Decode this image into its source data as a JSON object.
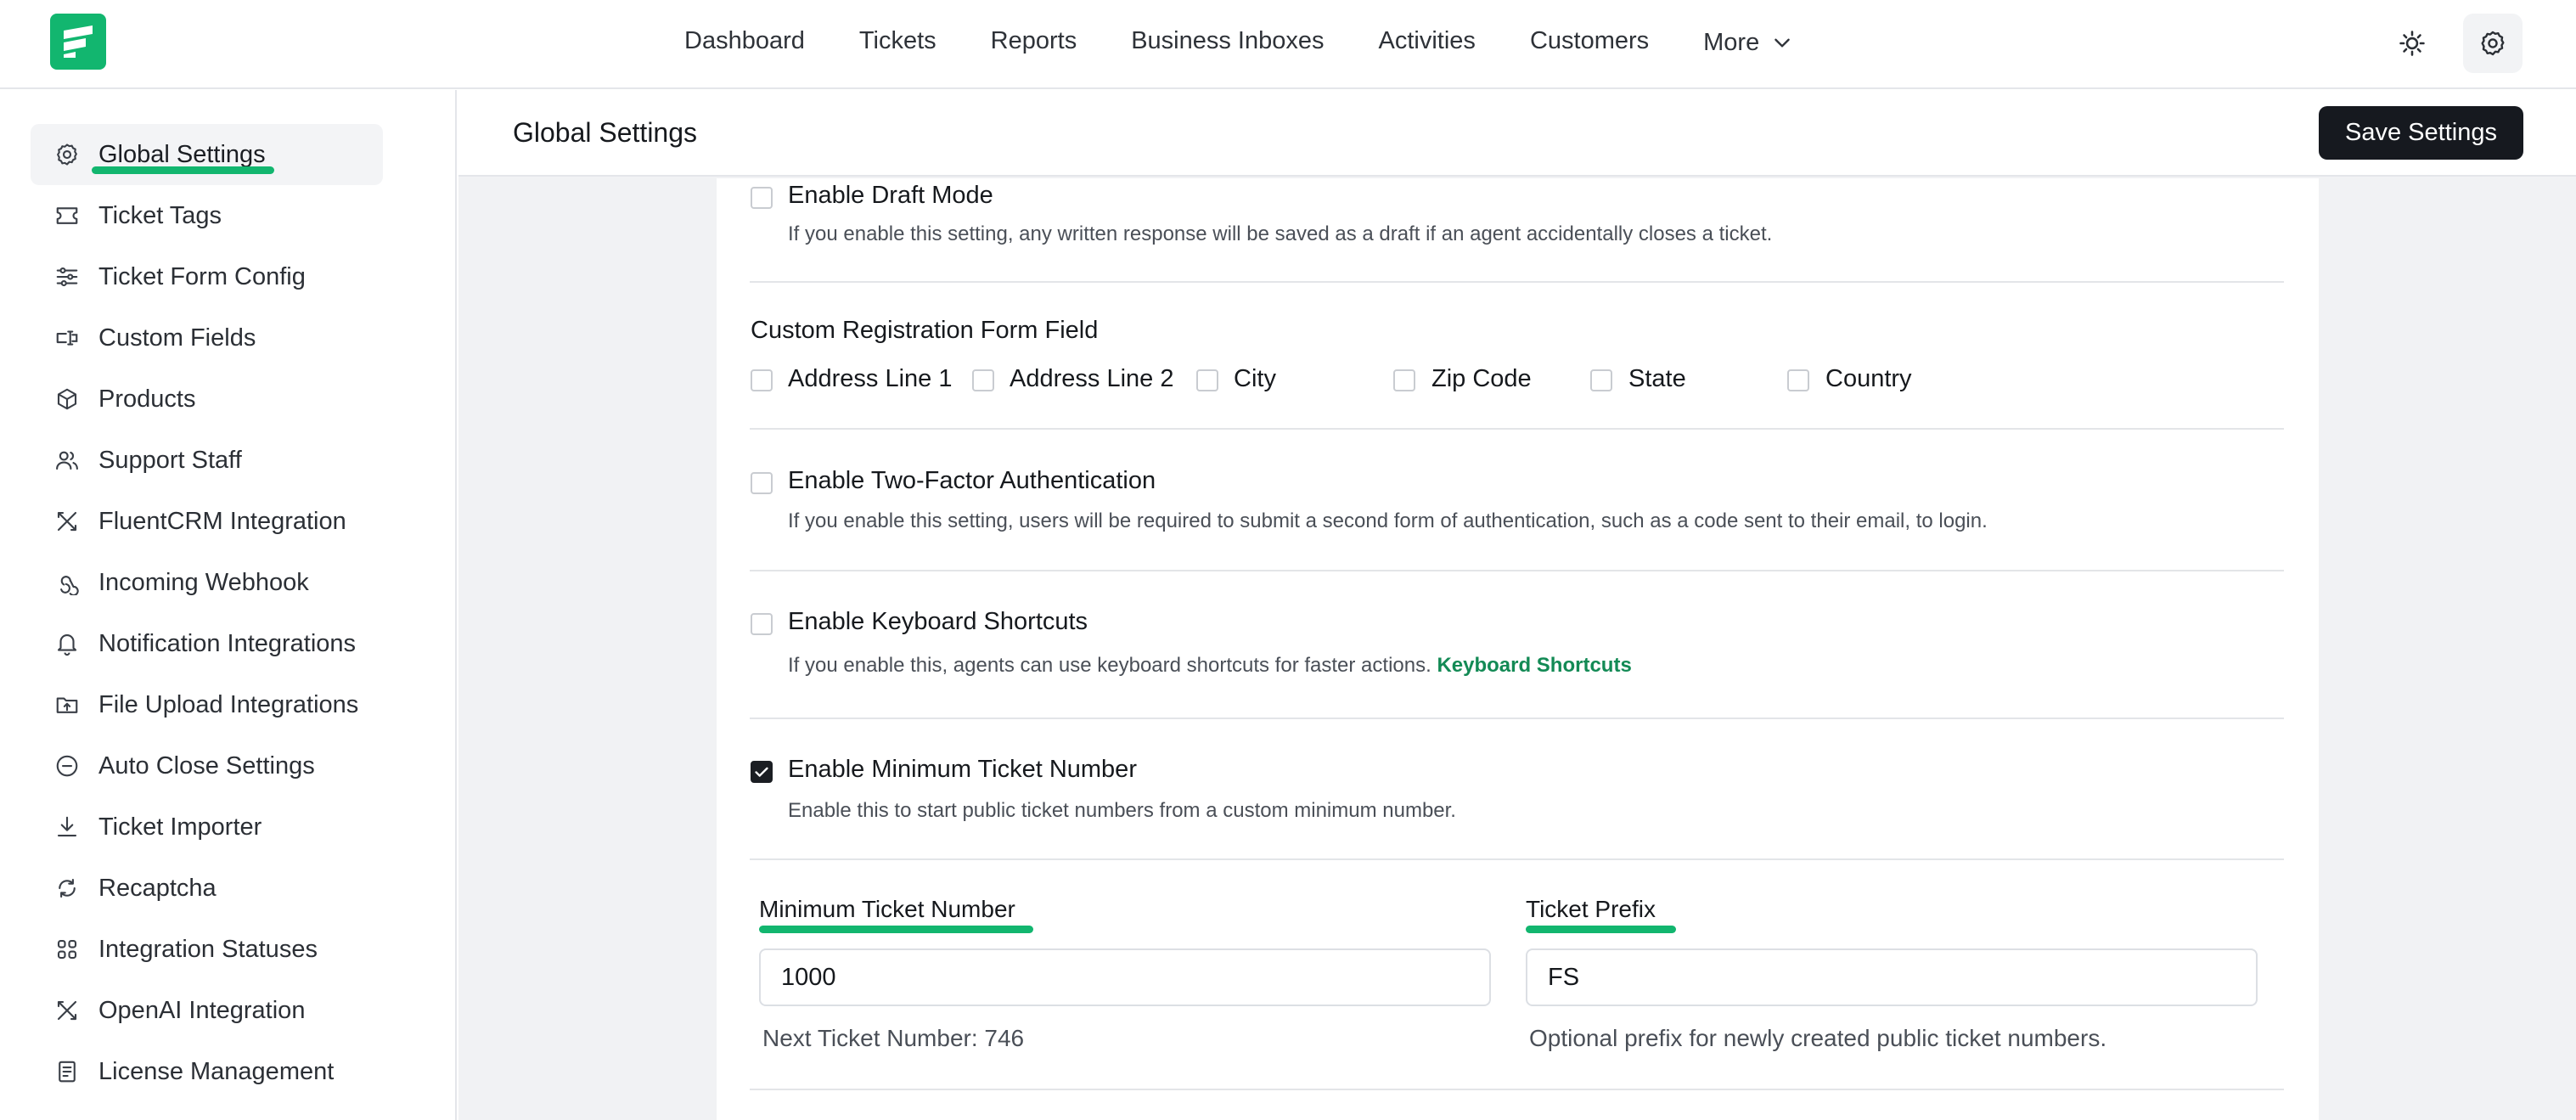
{
  "topnav": {
    "items": [
      {
        "label": "Dashboard"
      },
      {
        "label": "Tickets"
      },
      {
        "label": "Reports"
      },
      {
        "label": "Business Inboxes"
      },
      {
        "label": "Activities"
      },
      {
        "label": "Customers"
      },
      {
        "label": "More"
      }
    ],
    "icons": [
      "theme-toggle-icon",
      "gear-icon"
    ]
  },
  "sidebar": {
    "active": "Global Settings",
    "items": [
      {
        "label": "Global Settings",
        "icon": "gear-icon"
      },
      {
        "label": "Ticket Tags",
        "icon": "tag-icon"
      },
      {
        "label": "Ticket Form Config",
        "icon": "sliders-icon"
      },
      {
        "label": "Custom Fields",
        "icon": "custom-fields-icon"
      },
      {
        "label": "Products",
        "icon": "box-icon"
      },
      {
        "label": "Support Staff",
        "icon": "users-icon"
      },
      {
        "label": "FluentCRM Integration",
        "icon": "tools-icon"
      },
      {
        "label": "Incoming Webhook",
        "icon": "webhook-icon"
      },
      {
        "label": "Notification Integrations",
        "icon": "bell-icon"
      },
      {
        "label": "File Upload Integrations",
        "icon": "folder-upload-icon"
      },
      {
        "label": "Auto Close Settings",
        "icon": "minus-circle-icon"
      },
      {
        "label": "Ticket Importer",
        "icon": "download-icon"
      },
      {
        "label": "Recaptcha",
        "icon": "refresh-icon"
      },
      {
        "label": "Integration Statuses",
        "icon": "grid-icon"
      },
      {
        "label": "OpenAI Integration",
        "icon": "tools-icon"
      },
      {
        "label": "License Management",
        "icon": "document-icon"
      }
    ]
  },
  "header": {
    "title": "Global Settings",
    "save_label": "Save Settings"
  },
  "settings": {
    "draft_mode": {
      "title": "Enable Draft Mode",
      "desc": "If you enable this setting, any written response will be saved as a draft if an agent accidentally closes a ticket.",
      "checked": false
    },
    "registration": {
      "label": "Custom Registration Form Field",
      "fields": [
        {
          "label": "Address Line 1",
          "checked": false
        },
        {
          "label": "Address Line 2",
          "checked": false
        },
        {
          "label": "City",
          "checked": false
        },
        {
          "label": "Zip Code",
          "checked": false
        },
        {
          "label": "State",
          "checked": false
        },
        {
          "label": "Country",
          "checked": false
        }
      ]
    },
    "two_factor": {
      "title": "Enable Two-Factor Authentication",
      "desc": "If you enable this setting, users will be required to submit a second form of authentication, such as a code sent to their email, to login.",
      "checked": false
    },
    "shortcuts": {
      "title": "Enable Keyboard Shortcuts",
      "desc": "If you enable this, agents can use keyboard shortcuts for faster actions.",
      "link": "Keyboard Shortcuts",
      "checked": false
    },
    "min_ticket": {
      "title": "Enable Minimum Ticket Number",
      "desc": "Enable this to start public ticket numbers from a custom minimum number.",
      "checked": true
    },
    "min_number_field": {
      "label": "Minimum Ticket Number",
      "value": "1000",
      "help": "Next Ticket Number: 746"
    },
    "prefix_field": {
      "label": "Ticket Prefix",
      "value": "FS",
      "help": "Optional prefix for newly created public ticket numbers."
    }
  },
  "colors": {
    "accent": "#12b66f",
    "link": "#138a55",
    "primary_button": "#16191f",
    "page_bg": "#f1f2f4"
  }
}
